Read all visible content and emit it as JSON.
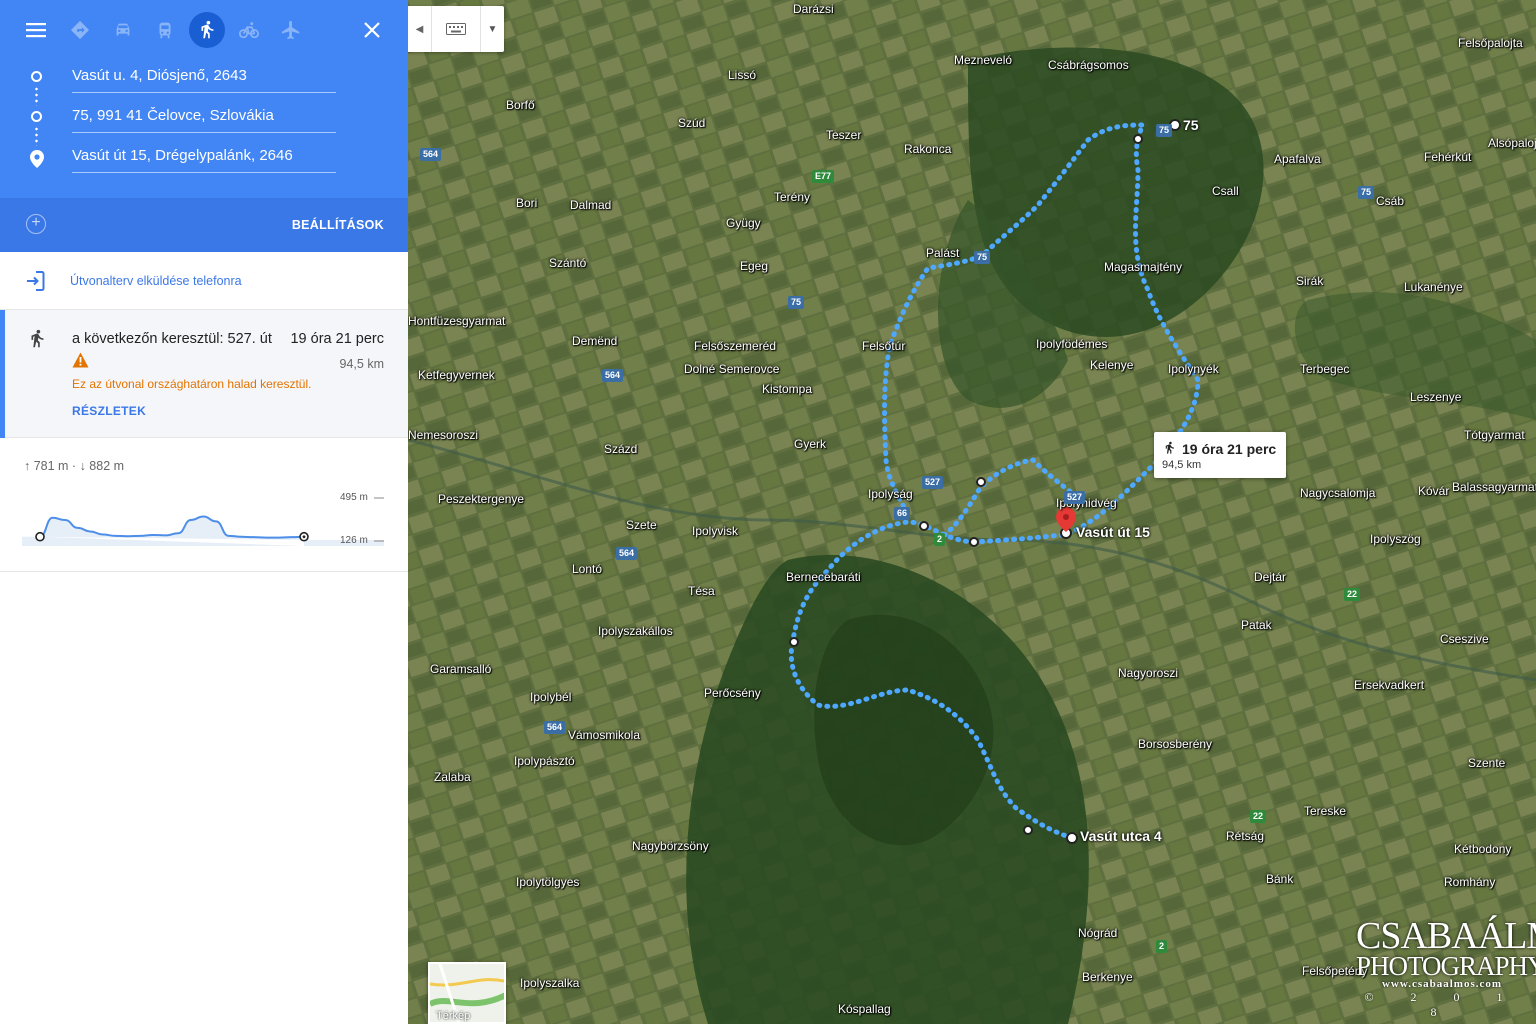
{
  "panel": {
    "waypoints": [
      {
        "value": "Vasút u. 4, Diósjenő, 2643"
      },
      {
        "value": "75, 991 41 Čelovce, Szlovákia"
      },
      {
        "value": "Vasút út 15, Drégelypalánk, 2646"
      }
    ],
    "options_label": "BEÁLLÍTÁSOK",
    "send_label": "Útvonalterv elküldése telefonra",
    "route": {
      "via": "a következőn keresztül: 527. út",
      "time": "19 óra 21 perc",
      "distance": "94,5 km",
      "warning": "Ez az útvonal országhatáron halad keresztül.",
      "details_label": "RÉSZLETEK"
    },
    "elevation": {
      "summary": "↑ 781 m · ↓ 882 m",
      "max_label": "495 m",
      "min_label": "126 m",
      "profile": [
        0.12,
        0.55,
        0.5,
        0.32,
        0.24,
        0.17,
        0.14,
        0.13,
        0.14,
        0.16,
        0.15,
        0.2,
        0.5,
        0.58,
        0.47,
        0.14,
        0.12,
        0.11,
        0.1,
        0.1,
        0.11,
        0.12
      ]
    }
  },
  "colors": {
    "header_blue": "#4285f4",
    "subbar_blue": "#3b78e7",
    "route_blue": "#4fa8ff",
    "warning_orange": "#e37400"
  },
  "icons": [
    "menu-icon",
    "directions-icon",
    "car-icon",
    "transit-icon",
    "walk-icon",
    "bike-icon",
    "flight-icon",
    "close-icon",
    "send-to-phone-icon",
    "warning-icon",
    "keyboard-icon",
    "destination-pin-icon"
  ],
  "map": {
    "places": [
      "Darázsi",
      "Lissó",
      "Mezneveló",
      "Csábrágsomos",
      "Felsőpalojta",
      "Borfő",
      "Szúd",
      "Teszer",
      "Rakonca",
      "Apafalva",
      "Fehérkút",
      "Alsópalojta",
      "Csall",
      "Csáb",
      "Bori",
      "Dalmad",
      "Terény",
      "Gyügy",
      "Szántó",
      "Egeg",
      "Palást",
      "Magasmajtény",
      "Sirák",
      "Lukanénye",
      "Hontfüzesgyarmat",
      "Demënd",
      "Felsőszemeréd",
      "Felsőtúr",
      "Ipolyfödémes",
      "Kelenye",
      "Ipolynyék",
      "Terbegec",
      "Leszenye",
      "Ketfegyvernek",
      "Dolné Semerovce",
      "Kistompa",
      "Nemesoroszi",
      "Százd",
      "Gyerk",
      "Tótgyarmat",
      "Peszektergenye",
      "Ipolyság",
      "Ipolyhidvég",
      "Nagycsalomja",
      "Kóvár",
      "Balassagyarmat",
      "Szete",
      "Ipolyvisk",
      "Ipolyszög",
      "Lontó",
      "Bernecebaráti",
      "Tésa",
      "Dejtár",
      "Ipolyszakállos",
      "Patak",
      "Cseszive",
      "Garamsalló",
      "Nagyoroszi",
      "Ersekvadkert",
      "Ipolybél",
      "Perőcsény",
      "Vámosmikola",
      "Borsosberény",
      "Ipolypásztó",
      "Szente",
      "Zalaba",
      "Tereske",
      "Nagybörzsöny",
      "Rétság",
      "Kétbodony",
      "Ipolytölgyes",
      "Bánk",
      "Romhány",
      "Nógrád",
      "Ipolyszalka",
      "Berkenye",
      "Felsőpetény",
      "Kóspallag"
    ],
    "roads": [
      "564",
      "75",
      "E77",
      "75",
      "75",
      "564",
      "75",
      "527",
      "527",
      "66",
      "2",
      "564",
      "22",
      "564",
      "22",
      "2"
    ],
    "labels": {
      "start": "Vasút utca 4",
      "via": "75",
      "end": "Vasút út 15"
    },
    "bubble": {
      "time": "19 óra 21 perc",
      "distance": "94,5 km"
    },
    "layer_label": "Térkép"
  },
  "watermark": {
    "name": "CSABAÁLMOS",
    "sub": "PHOTOGRAPHY",
    "url": "www.csabaalmos.com",
    "year": "© 2 0 1 8"
  }
}
